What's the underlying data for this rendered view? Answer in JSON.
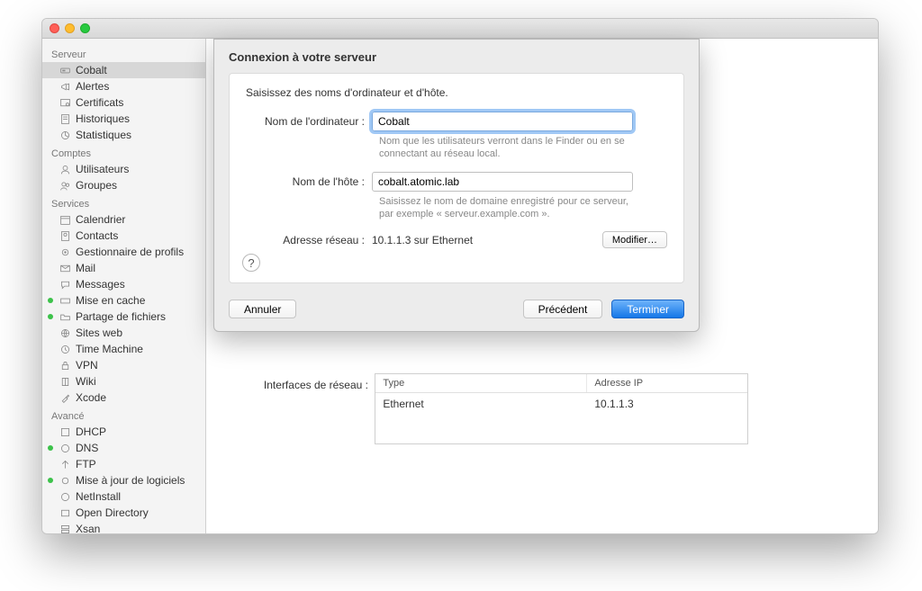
{
  "sheet": {
    "title": "Connexion à votre serveur",
    "instruction": "Saisissez des noms d'ordinateur et d'hôte.",
    "computer_label": "Nom de l'ordinateur :",
    "computer_value": "Cobalt",
    "computer_help": "Nom que les utilisateurs verront dans le Finder ou en se connectant au réseau local.",
    "host_label": "Nom de l'hôte :",
    "host_value": "cobalt.atomic.lab",
    "host_help": "Saisissez le nom de domaine enregistré pour ce serveur, par exemple « serveur.example.com ».",
    "addr_label": "Adresse réseau :",
    "addr_value": "10.1.1.3 sur Ethernet",
    "modify_btn": "Modifier…",
    "cancel_btn": "Annuler",
    "prev_btn": "Précédent",
    "finish_btn": "Terminer"
  },
  "net": {
    "section_label": "Interfaces de réseau :",
    "col_type": "Type",
    "col_ip": "Adresse IP",
    "row_type": "Ethernet",
    "row_ip": "10.1.1.3"
  },
  "sidebar": {
    "s1": "Serveur",
    "s1_items": [
      "Cobalt",
      "Alertes",
      "Certificats",
      "Historiques",
      "Statistiques"
    ],
    "s2": "Comptes",
    "s2_items": [
      "Utilisateurs",
      "Groupes"
    ],
    "s3": "Services",
    "s3_items": [
      "Calendrier",
      "Contacts",
      "Gestionnaire de profils",
      "Mail",
      "Messages",
      "Mise en cache",
      "Partage de fichiers",
      "Sites web",
      "Time Machine",
      "VPN",
      "Wiki",
      "Xcode"
    ],
    "s4": "Avancé",
    "s4_items": [
      "DHCP",
      "DNS",
      "FTP",
      "Mise à jour de logiciels",
      "NetInstall",
      "Open Directory",
      "Xsan"
    ]
  }
}
